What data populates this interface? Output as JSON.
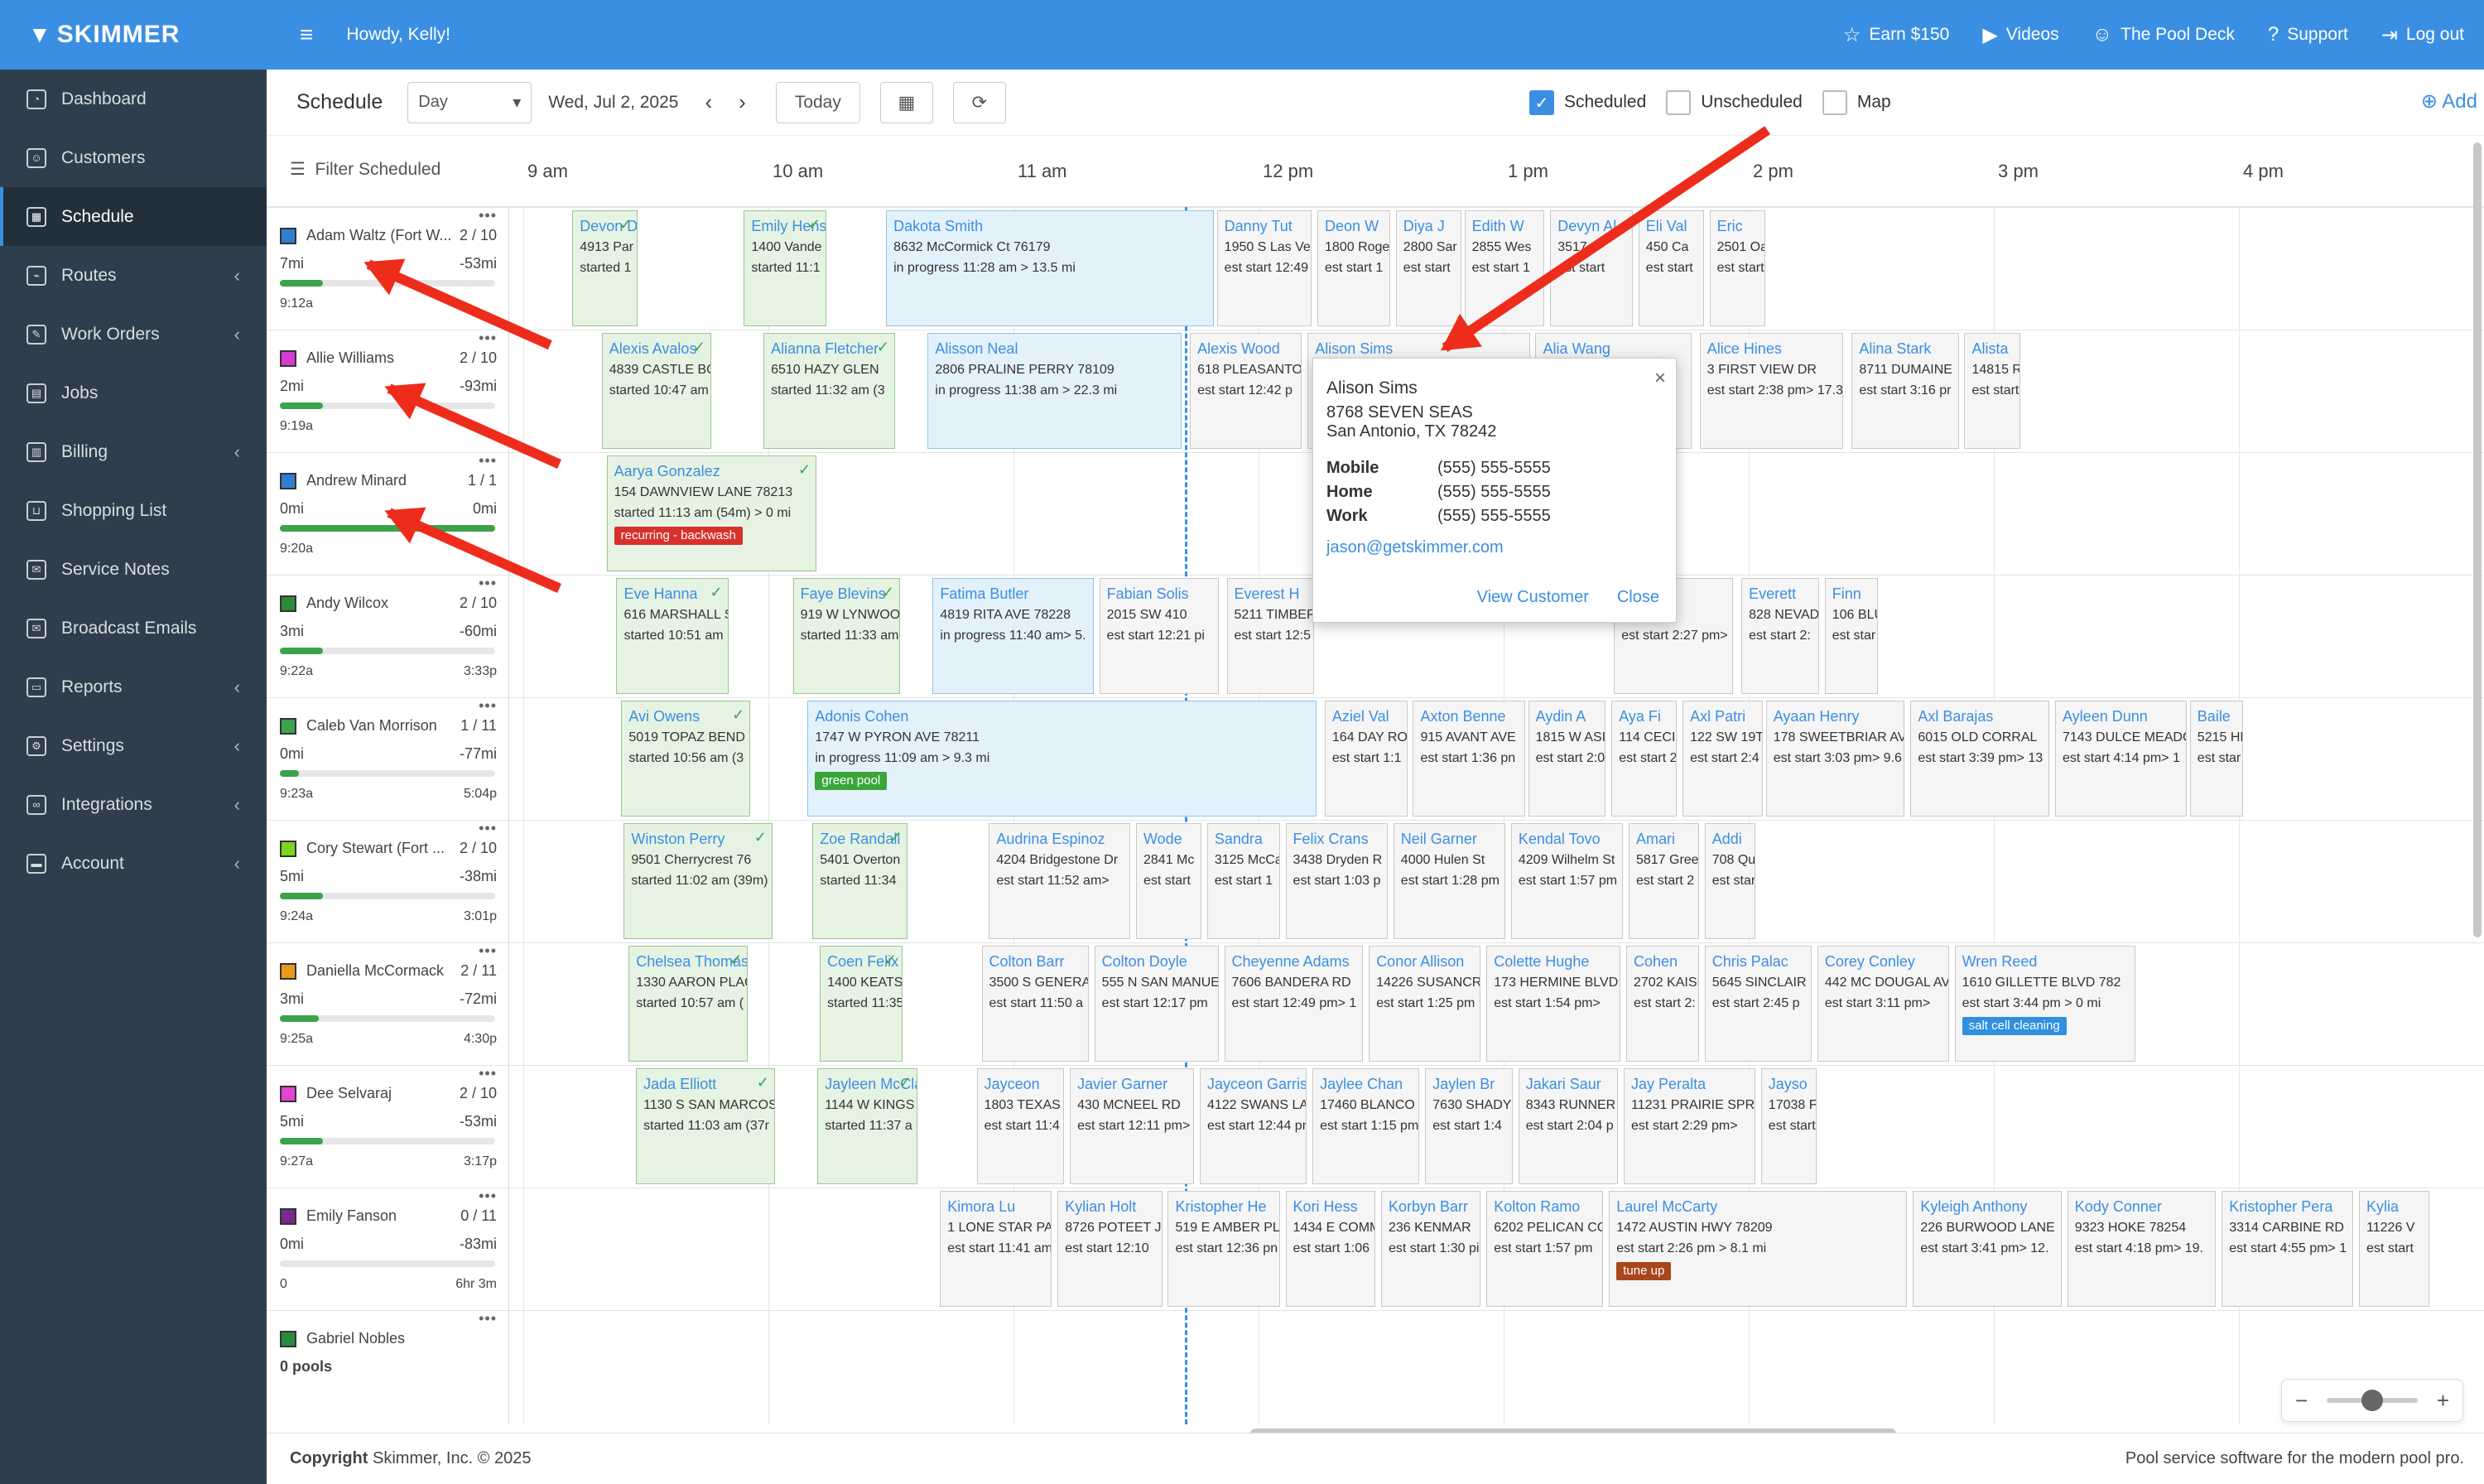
{
  "app": {
    "logo": "SKIMMER",
    "greeting": "Howdy, Kelly!"
  },
  "topbar": {
    "links": [
      {
        "label": "Earn $150",
        "icon": "star-icon"
      },
      {
        "label": "Videos",
        "icon": "play-icon"
      },
      {
        "label": "The Pool Deck",
        "icon": "people-icon"
      },
      {
        "label": "Support",
        "icon": "help-icon"
      },
      {
        "label": "Log out",
        "icon": "logout-icon"
      }
    ]
  },
  "sidebar": {
    "items": [
      {
        "label": "Dashboard",
        "icon": "gauge-icon",
        "chev": false
      },
      {
        "label": "Customers",
        "icon": "people-icon",
        "chev": false
      },
      {
        "label": "Schedule",
        "icon": "calendar-icon",
        "chev": false,
        "active": true
      },
      {
        "label": "Routes",
        "icon": "route-icon",
        "chev": true
      },
      {
        "label": "Work Orders",
        "icon": "wrench-icon",
        "chev": true
      },
      {
        "label": "Jobs",
        "icon": "clipboard-icon",
        "chev": false
      },
      {
        "label": "Billing",
        "icon": "invoice-icon",
        "chev": true
      },
      {
        "label": "Shopping List",
        "icon": "cart-icon",
        "chev": false
      },
      {
        "label": "Service Notes",
        "icon": "note-icon",
        "chev": false
      },
      {
        "label": "Broadcast Emails",
        "icon": "envelope-icon",
        "chev": false
      },
      {
        "label": "Reports",
        "icon": "printer-icon",
        "chev": true
      },
      {
        "label": "Settings",
        "icon": "gear-icon",
        "chev": true
      },
      {
        "label": "Integrations",
        "icon": "link-icon",
        "chev": true
      },
      {
        "label": "Account",
        "icon": "card-icon",
        "chev": true
      }
    ]
  },
  "toolbar": {
    "title": "Schedule",
    "view": "Day",
    "date": "Wed, Jul 2, 2025",
    "today": "Today",
    "filters": [
      {
        "label": "Scheduled",
        "checked": true
      },
      {
        "label": "Unscheduled",
        "checked": false
      },
      {
        "label": "Map",
        "checked": false
      }
    ],
    "add": "Add"
  },
  "grid": {
    "filter_label": "Filter Scheduled",
    "hours": [
      "9 am",
      "10 am",
      "11 am",
      "12 pm",
      "1 pm",
      "2 pm",
      "3 pm",
      "4 pm"
    ]
  },
  "techs": [
    {
      "name": "Adam Waltz (Fort W...",
      "count": "2 / 10",
      "miles": "7mi",
      "delta": "-53mi",
      "start": "9:12a",
      "end": "",
      "progress": 0.2,
      "color": "#2f7fd1"
    },
    {
      "name": "Allie Williams",
      "count": "2 / 10",
      "miles": "2mi",
      "delta": "-93mi",
      "start": "9:19a",
      "end": "",
      "progress": 0.2,
      "color": "#d63bd6"
    },
    {
      "name": "Andrew Minard",
      "count": "1 / 1",
      "miles": "0mi",
      "delta": "0mi",
      "start": "9:20a",
      "end": "",
      "progress": 1.0,
      "color": "#2f7fd1"
    },
    {
      "name": "Andy Wilcox",
      "count": "2 / 10",
      "miles": "3mi",
      "delta": "-60mi",
      "start": "9:22a",
      "end": "3:33p",
      "progress": 0.2,
      "color": "#2b8a3a"
    },
    {
      "name": "Caleb Van Morrison",
      "count": "1 / 11",
      "miles": "0mi",
      "delta": "-77mi",
      "start": "9:23a",
      "end": "5:04p",
      "progress": 0.09,
      "color": "#3ca34a"
    },
    {
      "name": "Cory Stewart (Fort ...",
      "count": "2 / 10",
      "miles": "5mi",
      "delta": "-38mi",
      "start": "9:24a",
      "end": "3:01p",
      "progress": 0.2,
      "color": "#7ed321"
    },
    {
      "name": "Daniella McCormack",
      "count": "2 / 11",
      "miles": "3mi",
      "delta": "-72mi",
      "start": "9:25a",
      "end": "4:30p",
      "progress": 0.18,
      "color": "#e89a1a"
    },
    {
      "name": "Dee Selvaraj",
      "count": "2 / 10",
      "miles": "5mi",
      "delta": "-53mi",
      "start": "9:27a",
      "end": "3:17p",
      "progress": 0.2,
      "color": "#e044d0"
    },
    {
      "name": "Emily Fanson",
      "count": "0 / 11",
      "miles": "0mi",
      "delta": "-83mi",
      "start": "0",
      "end": "6hr 3m",
      "progress": 0,
      "color": "#7a2a8a"
    },
    {
      "name": "Gabriel Nobles",
      "count": "",
      "miles": "0 pools",
      "delta": "",
      "start": "",
      "end": "",
      "progress": 0,
      "color": "#2b8a3a"
    }
  ],
  "cards": [
    {
      "row": 0,
      "h": 9.2,
      "w": 0.28,
      "s": "done",
      "name": "Devon D",
      "l2": "4913 Par",
      "l3": "started 1"
    },
    {
      "row": 0,
      "h": 9.9,
      "w": 0.35,
      "s": "done",
      "name": "Emily Hens",
      "l2": "1400 Vande",
      "l3": "started 11:1"
    },
    {
      "row": 0,
      "h": 10.48,
      "w": 1.35,
      "s": "prog",
      "name": "Dakota Smith",
      "l2": "8632 McCormick Ct                          76179",
      "l3": "in progress 11:28 am                        > 13.5 mi"
    },
    {
      "row": 0,
      "h": 11.83,
      "w": 0.4,
      "s": "sched",
      "name": "Danny Tut",
      "l2": "1950 S Las Veg",
      "l3": "est start 12:49"
    },
    {
      "row": 0,
      "h": 12.24,
      "w": 0.31,
      "s": "sched",
      "name": "Deon W",
      "l2": "1800 Roge",
      "l3": "est start 1"
    },
    {
      "row": 0,
      "h": 12.56,
      "w": 0.28,
      "s": "sched",
      "name": "Diya J",
      "l2": "2800 Sar",
      "l3": "est start"
    },
    {
      "row": 0,
      "h": 12.84,
      "w": 0.34,
      "s": "sched",
      "name": "Edith W",
      "l2": "2855 Wes",
      "l3": "est start 1"
    },
    {
      "row": 0,
      "h": 13.19,
      "w": 0.35,
      "s": "sched",
      "name": "Devyn Al",
      "l2": "3517 S",
      "l3": "est start"
    },
    {
      "row": 0,
      "h": 13.55,
      "w": 0.28,
      "s": "sched",
      "name": "Eli Val",
      "l2": "450 Ca",
      "l3": "est start"
    },
    {
      "row": 0,
      "h": 13.84,
      "w": 0.24,
      "s": "sched",
      "name": "Eric",
      "l2": "2501 Oa",
      "l3": "est start"
    },
    {
      "row": 1,
      "h": 9.32,
      "w": 0.46,
      "s": "done",
      "name": "Alexis Avalos",
      "l2": "4839 CASTLE BC",
      "l3": "started 10:47 am"
    },
    {
      "row": 1,
      "h": 9.98,
      "w": 0.55,
      "s": "done",
      "name": "Alianna Fletcher",
      "l2": "6510 HAZY GLEN",
      "l3": "started 11:32 am (3"
    },
    {
      "row": 1,
      "h": 10.65,
      "w": 1.05,
      "s": "prog",
      "name": "Alisson Neal",
      "l2": "2806 PRALINE PERRY             78109",
      "l3": "in progress 11:38 am           > 22.3 mi"
    },
    {
      "row": 1,
      "h": 11.72,
      "w": 0.47,
      "s": "sched",
      "name": "Alexis Wood",
      "l2": "618 PLEASANTO",
      "l3": "est start 12:42 p"
    },
    {
      "row": 1,
      "h": 12.2,
      "w": 0.92,
      "s": "sched",
      "name": "Alison Sims",
      "l2": "8768 SEVEN SEAS",
      "l3": "est start 1:08 pm"
    },
    {
      "row": 1,
      "h": 13.13,
      "w": 0.65,
      "s": "sched",
      "name": "Alia Wang",
      "l2": "7718 WEST",
      "l3": "est start"
    },
    {
      "row": 1,
      "h": 13.8,
      "w": 0.6,
      "s": "sched",
      "name": "Alice Hines",
      "l2": "3 FIRST VIEW DR",
      "l3": "est start 2:38 pm> 17.3"
    },
    {
      "row": 1,
      "h": 14.42,
      "w": 0.45,
      "s": "sched",
      "name": "Alina Stark",
      "l2": "8711 DUMAINE",
      "l3": "est start 3:16 pr"
    },
    {
      "row": 1,
      "h": 14.88,
      "w": 0.24,
      "s": "sched",
      "name": "Alista",
      "l2": "14815 R",
      "l3": "est start"
    },
    {
      "row": 2,
      "h": 9.34,
      "w": 0.87,
      "s": "done",
      "name": "Aarya Gonzalez",
      "l2": "154 DAWNVIEW LANE          78213",
      "l3": "started 11:13 am (54m)      > 0 mi",
      "tag": "recurring - backwash",
      "tagc": "#d9302c"
    },
    {
      "row": 3,
      "h": 9.38,
      "w": 0.47,
      "s": "done",
      "name": "Eve Hanna",
      "l2": "616 MARSHALL S",
      "l3": "started 10:51 am"
    },
    {
      "row": 3,
      "h": 10.1,
      "w": 0.45,
      "s": "done",
      "name": "Faye Blevins",
      "l2": "919 W LYNWOO",
      "l3": "started 11:33 am"
    },
    {
      "row": 3,
      "h": 10.67,
      "w": 0.67,
      "s": "prog",
      "name": "Fatima Butler",
      "l2": "4819 RITA AVE        78228",
      "l3": "in progress 11:40 am> 5."
    },
    {
      "row": 3,
      "h": 11.35,
      "w": 0.5,
      "s": "sched",
      "name": "Fabian Solis",
      "l2": "2015 SW 410",
      "l3": "est start 12:21 pi"
    },
    {
      "row": 3,
      "h": 11.87,
      "w": 0.37,
      "s": "sched",
      "name": "Everest H",
      "l2": "5211 TIMBER",
      "l3": "est start 12:5"
    },
    {
      "row": 3,
      "h": 13.45,
      "w": 0.5,
      "s": "sched",
      "name": "Evelynh",
      "l2": "WAY",
      "l3": "est start 2:27 pm>"
    },
    {
      "row": 3,
      "h": 13.97,
      "w": 0.33,
      "s": "sched",
      "name": "Everett",
      "l2": "828 NEVAD",
      "l3": "est start 2:"
    },
    {
      "row": 3,
      "h": 14.31,
      "w": 0.23,
      "s": "sched",
      "name": "Finn",
      "l2": "106 BLU",
      "l3": "est star"
    },
    {
      "row": 4,
      "h": 9.4,
      "w": 0.54,
      "s": "done",
      "name": "Avi Owens",
      "l2": "5019 TOPAZ BEND",
      "l3": "started 10:56 am (3"
    },
    {
      "row": 4,
      "h": 10.16,
      "w": 2.09,
      "s": "prog",
      "name": "Adonis Cohen",
      "l2": "1747 W PYRON AVE                                                                    78211",
      "l3": "in progress 11:09 am                                                                  > 9.3 mi",
      "tag": "green pool",
      "tagc": "#3aa63a"
    },
    {
      "row": 4,
      "h": 12.27,
      "w": 0.35,
      "s": "sched",
      "name": "Aziel Val",
      "l2": "164 DAY RO",
      "l3": "est start 1:1"
    },
    {
      "row": 4,
      "h": 12.63,
      "w": 0.47,
      "s": "sched",
      "name": "Axton Benne",
      "l2": "915 AVANT AVE",
      "l3": "est start 1:36 pn"
    },
    {
      "row": 4,
      "h": 13.1,
      "w": 0.33,
      "s": "sched",
      "name": "Aydin A",
      "l2": "1815 W ASI",
      "l3": "est start 2:0"
    },
    {
      "row": 4,
      "h": 13.44,
      "w": 0.28,
      "s": "sched",
      "name": "Aya Fi",
      "l2": "114 CECIL",
      "l3": "est start 2"
    },
    {
      "row": 4,
      "h": 13.73,
      "w": 0.34,
      "s": "sched",
      "name": "Axl Patri",
      "l2": "122 SW 19T",
      "l3": "est start 2:4"
    },
    {
      "row": 4,
      "h": 14.07,
      "w": 0.58,
      "s": "sched",
      "name": "Ayaan Henry",
      "l2": "178 SWEETBRIAR AVE",
      "l3": "est start 3:03 pm> 9.6"
    },
    {
      "row": 4,
      "h": 14.66,
      "w": 0.58,
      "s": "sched",
      "name": "Axl Barajas",
      "l2": "6015 OLD CORRAL",
      "l3": "est start 3:39 pm> 13"
    },
    {
      "row": 4,
      "h": 15.25,
      "w": 0.55,
      "s": "sched",
      "name": "Ayleen Dunn",
      "l2": "7143 DULCE MEADO",
      "l3": "est start 4:14 pm> 1"
    },
    {
      "row": 4,
      "h": 15.8,
      "w": 0.23,
      "s": "sched",
      "name": "Baile",
      "l2": "5215 HE",
      "l3": "est star"
    },
    {
      "row": 5,
      "h": 9.41,
      "w": 0.62,
      "s": "done",
      "name": "Winston Perry",
      "l2": "9501 Cherrycrest         76",
      "l3": "started 11:02 am (39m)"
    },
    {
      "row": 5,
      "h": 10.18,
      "w": 0.4,
      "s": "done",
      "name": "Zoe Randall",
      "l2": "5401 Overton",
      "l3": "started 11:34"
    },
    {
      "row": 5,
      "h": 10.9,
      "w": 0.59,
      "s": "sched",
      "name": "Audrina Espinoz",
      "l2": "4204 Bridgestone Dr",
      "l3": "est start 11:52 am>"
    },
    {
      "row": 5,
      "h": 11.5,
      "w": 0.28,
      "s": "sched",
      "name": "Wode",
      "l2": "2841 Mc",
      "l3": "est start"
    },
    {
      "row": 5,
      "h": 11.79,
      "w": 0.31,
      "s": "sched",
      "name": "Sandra",
      "l2": "3125 McCa",
      "l3": "est start 1"
    },
    {
      "row": 5,
      "h": 12.11,
      "w": 0.43,
      "s": "sched",
      "name": "Felix Crans",
      "l2": "3438 Dryden R",
      "l3": "est start 1:03 p"
    },
    {
      "row": 5,
      "h": 12.55,
      "w": 0.47,
      "s": "sched",
      "name": "Neil Garner",
      "l2": "4000 Hulen St",
      "l3": "est start 1:28 pm"
    },
    {
      "row": 5,
      "h": 13.03,
      "w": 0.47,
      "s": "sched",
      "name": "Kendal Tovo",
      "l2": "4209 Wilhelm St",
      "l3": "est start 1:57 pm"
    },
    {
      "row": 5,
      "h": 13.51,
      "w": 0.3,
      "s": "sched",
      "name": "Amari",
      "l2": "5817 Gree",
      "l3": "est start 2"
    },
    {
      "row": 5,
      "h": 13.82,
      "w": 0.22,
      "s": "sched",
      "name": "Addi",
      "l2": "708 Qua",
      "l3": "est start"
    },
    {
      "row": 6,
      "h": 9.43,
      "w": 0.5,
      "s": "done",
      "name": "Chelsea Thomas",
      "l2": "1330 AARON PLAC",
      "l3": "started 10:57 am ("
    },
    {
      "row": 6,
      "h": 10.21,
      "w": 0.35,
      "s": "done",
      "name": "Coen Felix",
      "l2": "1400 KEATS",
      "l3": "started 11:35"
    },
    {
      "row": 6,
      "h": 10.87,
      "w": 0.45,
      "s": "sched",
      "name": "Colton Barr",
      "l2": "3500 S GENERA",
      "l3": "est start 11:50 a"
    },
    {
      "row": 6,
      "h": 11.33,
      "w": 0.52,
      "s": "sched",
      "name": "Colton Doyle",
      "l2": "555 N SAN MANUE",
      "l3": "est start 12:17 pm"
    },
    {
      "row": 6,
      "h": 11.86,
      "w": 0.58,
      "s": "sched",
      "name": "Cheyenne Adams",
      "l2": "7606 BANDERA RD",
      "l3": "est start 12:49 pm> 1"
    },
    {
      "row": 6,
      "h": 12.45,
      "w": 0.47,
      "s": "sched",
      "name": "Conor Allison",
      "l2": "14226 SUSANCRE",
      "l3": "est start 1:25 pm"
    },
    {
      "row": 6,
      "h": 12.93,
      "w": 0.56,
      "s": "sched",
      "name": "Colette Hughe",
      "l2": "173 HERMINE BLVD",
      "l3": "est start 1:54 pm>"
    },
    {
      "row": 6,
      "h": 13.5,
      "w": 0.31,
      "s": "sched",
      "name": "Cohen",
      "l2": "2702 KAISE",
      "l3": "est start 2:"
    },
    {
      "row": 6,
      "h": 13.82,
      "w": 0.45,
      "s": "sched",
      "name": "Chris Palac",
      "l2": "5645 SINCLAIR",
      "l3": "est start 2:45 p"
    },
    {
      "row": 6,
      "h": 14.28,
      "w": 0.55,
      "s": "sched",
      "name": "Corey Conley",
      "l2": "442 MC DOUGAL AV",
      "l3": "est start 3:11 pm>"
    },
    {
      "row": 6,
      "h": 14.84,
      "w": 0.75,
      "s": "sched",
      "name": "Wren Reed",
      "l2": "1610 GILLETTE BLVD         782",
      "l3": "est start 3:44 pm             > 0 mi",
      "tag": "salt cell cleaning",
      "tagc": "#2f8fe0"
    },
    {
      "row": 7,
      "h": 9.46,
      "w": 0.58,
      "s": "done",
      "name": "Jada Elliott",
      "l2": "1130 S SAN MARCOS",
      "l3": "started 11:03 am (37r"
    },
    {
      "row": 7,
      "h": 10.2,
      "w": 0.42,
      "s": "done",
      "name": "Jayleen McCla",
      "l2": "1144 W KINGS",
      "l3": "started 11:37 a"
    },
    {
      "row": 7,
      "h": 10.85,
      "w": 0.37,
      "s": "sched",
      "name": "Jayceon",
      "l2": "1803 TEXAS",
      "l3": "est start 11:4"
    },
    {
      "row": 7,
      "h": 11.23,
      "w": 0.52,
      "s": "sched",
      "name": "Javier Garner",
      "l2": "430 MCNEEL RD",
      "l3": "est start 12:11 pm>"
    },
    {
      "row": 7,
      "h": 11.76,
      "w": 0.45,
      "s": "sched",
      "name": "Jayceon Garris",
      "l2": "4122 SWANS LANE",
      "l3": "est start 12:44 pn"
    },
    {
      "row": 7,
      "h": 12.22,
      "w": 0.45,
      "s": "sched",
      "name": "Jaylee Chan",
      "l2": "17460 BLANCO",
      "l3": "est start 1:15 pm"
    },
    {
      "row": 7,
      "h": 12.68,
      "w": 0.37,
      "s": "sched",
      "name": "Jaylen Br",
      "l2": "7630 SHADY",
      "l3": "est start 1:4"
    },
    {
      "row": 7,
      "h": 13.06,
      "w": 0.42,
      "s": "sched",
      "name": "Jakari Saur",
      "l2": "8343 RUNNER",
      "l3": "est start 2:04 p"
    },
    {
      "row": 7,
      "h": 13.49,
      "w": 0.55,
      "s": "sched",
      "name": "Jay Peralta",
      "l2": "11231 PRAIRIE SPR",
      "l3": "est start 2:29 pm>"
    },
    {
      "row": 7,
      "h": 14.05,
      "w": 0.24,
      "s": "sched",
      "name": "Jayso",
      "l2": "17038 F",
      "l3": "est start"
    },
    {
      "row": 8,
      "h": 10.7,
      "w": 0.47,
      "s": "sched",
      "name": "Kimora Lu",
      "l2": "1 LONE STAR PAS",
      "l3": "est start 11:41 am"
    },
    {
      "row": 8,
      "h": 11.18,
      "w": 0.44,
      "s": "sched",
      "name": "Kylian Holt",
      "l2": "8726 POTEET JO",
      "l3": "est start 12:10"
    },
    {
      "row": 8,
      "h": 11.63,
      "w": 0.47,
      "s": "sched",
      "name": "Kristopher He",
      "l2": "519 E AMBER PLA",
      "l3": "est start 12:36 pn"
    },
    {
      "row": 8,
      "h": 12.11,
      "w": 0.38,
      "s": "sched",
      "name": "Kori Hess",
      "l2": "1434 E COMM",
      "l3": "est start 1:06"
    },
    {
      "row": 8,
      "h": 12.5,
      "w": 0.42,
      "s": "sched",
      "name": "Korbyn Barr",
      "l2": "236 KENMAR",
      "l3": "est start 1:30 pi"
    },
    {
      "row": 8,
      "h": 12.93,
      "w": 0.49,
      "s": "sched",
      "name": "Kolton Ramo",
      "l2": "6202 PELICAN CC",
      "l3": "est start 1:57 pm"
    },
    {
      "row": 8,
      "h": 13.43,
      "w": 1.23,
      "s": "sched",
      "name": "Laurel McCarty",
      "l2": "1472 AUSTIN HWY                               78209",
      "l3": "est start 2:26 pm                             > 8.1 mi",
      "tag": "tune up",
      "tagc": "#a8461c"
    },
    {
      "row": 8,
      "h": 14.67,
      "w": 0.62,
      "s": "sched",
      "name": "Kyleigh Anthony",
      "l2": "226 BURWOOD LANE",
      "l3": "est start 3:41 pm> 12."
    },
    {
      "row": 8,
      "h": 15.3,
      "w": 0.62,
      "s": "sched",
      "name": "Kody Conner",
      "l2": "9323 HOKE          78254",
      "l3": "est start 4:18 pm> 19."
    },
    {
      "row": 8,
      "h": 15.93,
      "w": 0.55,
      "s": "sched",
      "name": "Kristopher Pera",
      "l2": "3314 CARBINE RD",
      "l3": "est start 4:55 pm> 1"
    },
    {
      "row": 8,
      "h": 16.49,
      "w": 0.3,
      "s": "sched",
      "name": "Kylia",
      "l2": "11226 V",
      "l3": "est start"
    }
  ],
  "popup": {
    "name": "Alison Sims",
    "addr1": "8768 SEVEN SEAS",
    "addr2": "San Antonio, TX 78242",
    "phones": [
      {
        "k": "Mobile",
        "v": "(555) 555-5555"
      },
      {
        "k": "Home",
        "v": "(555) 555-5555"
      },
      {
        "k": "Work",
        "v": "(555) 555-5555"
      }
    ],
    "email": "jason@getskimmer.com",
    "view": "View Customer",
    "close": "Close"
  },
  "footer": {
    "copyright": "Copyright",
    "company": " Skimmer, Inc. © 2025",
    "tagline": "Pool service software for the modern pool pro."
  }
}
